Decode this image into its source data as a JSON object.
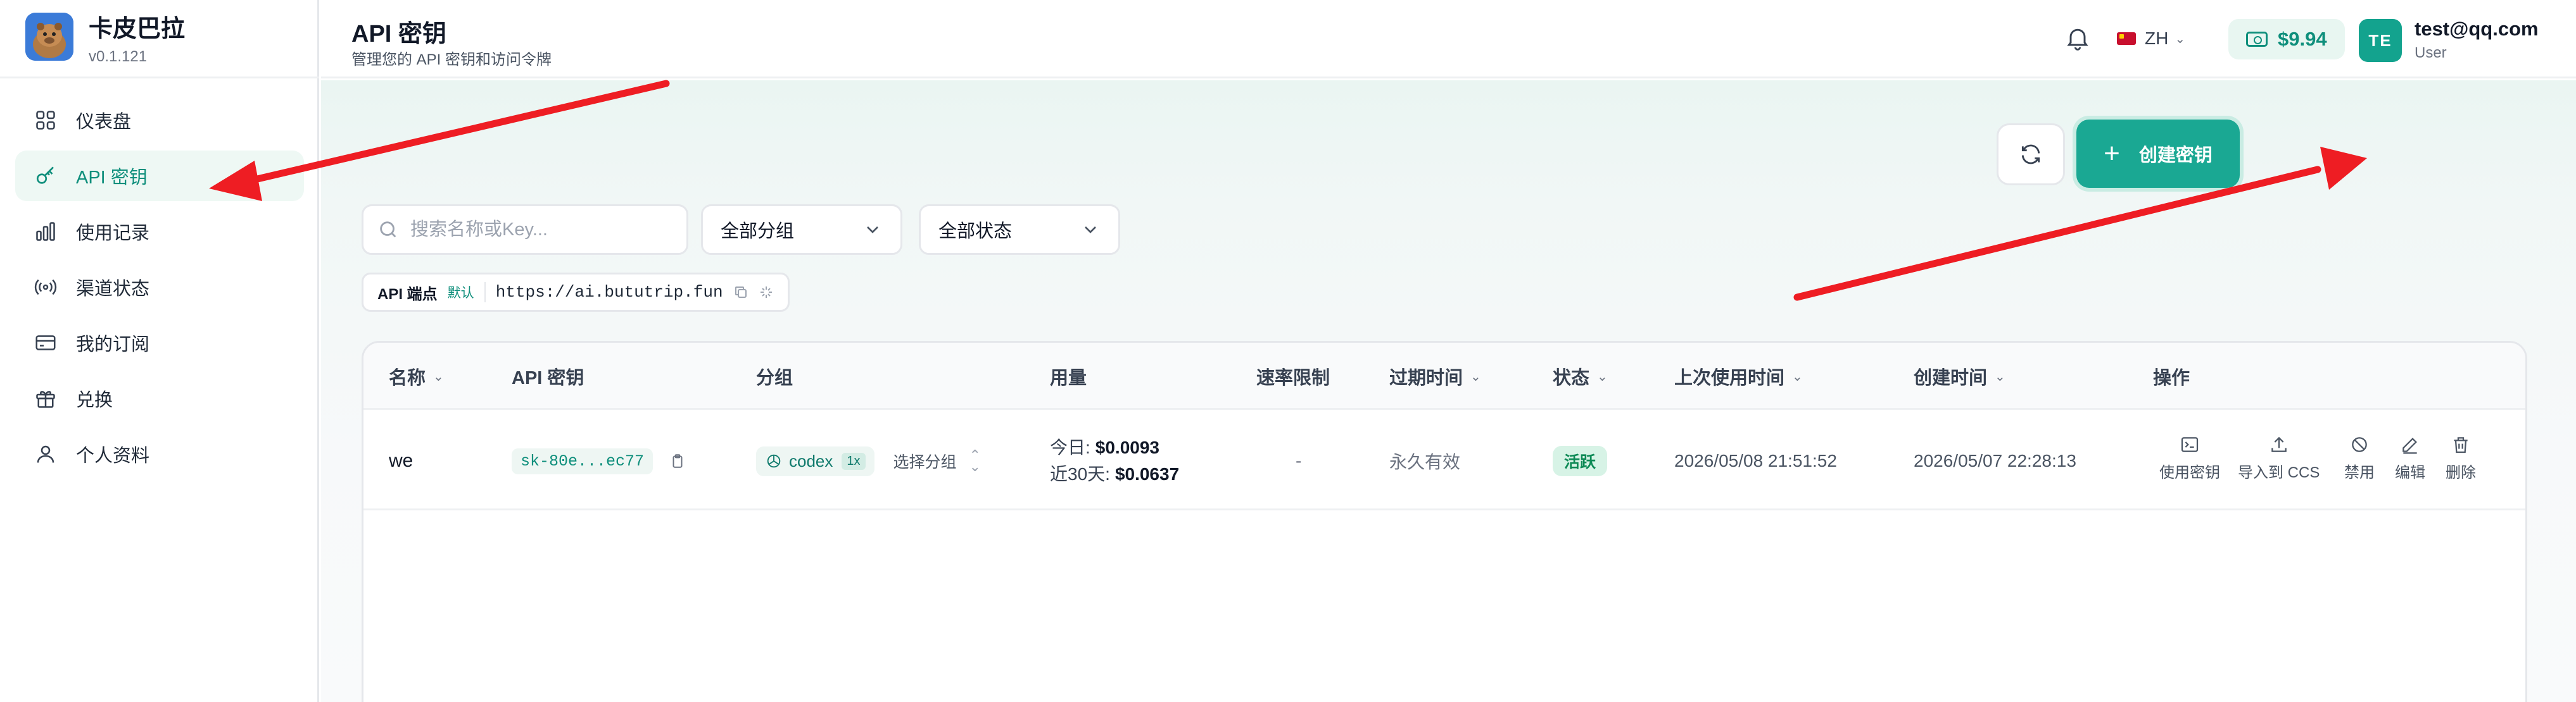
{
  "brand": {
    "name": "卡皮巴拉",
    "version": "v0.1.121"
  },
  "sidebar": {
    "items": [
      {
        "label": "仪表盘"
      },
      {
        "label": "API 密钥"
      },
      {
        "label": "使用记录"
      },
      {
        "label": "渠道状态"
      },
      {
        "label": "我的订阅"
      },
      {
        "label": "兑换"
      },
      {
        "label": "个人资料"
      }
    ]
  },
  "header": {
    "title": "API 密钥",
    "subtitle": "管理您的 API 密钥和访问令牌",
    "language": "ZH",
    "balance": "$9.94",
    "avatar_initials": "TE",
    "user_email": "test@qq.com",
    "user_role": "User"
  },
  "toolbar": {
    "create_label": "创建密钥"
  },
  "filters": {
    "search_placeholder": "搜索名称或Key...",
    "group_select": "全部分组",
    "status_select": "全部状态"
  },
  "endpoint": {
    "label": "API 端点",
    "badge": "默认",
    "url": "https://ai.bututrip.fun"
  },
  "table": {
    "columns": [
      "名称",
      "API 密钥",
      "分组",
      "用量",
      "速率限制",
      "过期时间",
      "状态",
      "上次使用时间",
      "创建时间",
      "操作"
    ],
    "rows": [
      {
        "name": "we",
        "key": "sk-80e...ec77",
        "group": "codex",
        "multiplier": "1x",
        "choose_group": "选择分组",
        "usage_today_label": "今日:",
        "usage_today": "$0.0093",
        "usage_30d_label": "近30天:",
        "usage_30d": "$0.0637",
        "rate_limit": "-",
        "expires": "永久有效",
        "status": "活跃",
        "last_used": "2026/05/08 21:51:52",
        "created": "2026/05/07 22:28:13"
      }
    ],
    "actions": [
      "使用密钥",
      "导入到 CCS",
      "禁用",
      "编辑",
      "删除"
    ]
  },
  "colors": {
    "accent": "#1aa893",
    "active_bg": "#eef8f4",
    "arrow": "#ee1d23"
  }
}
